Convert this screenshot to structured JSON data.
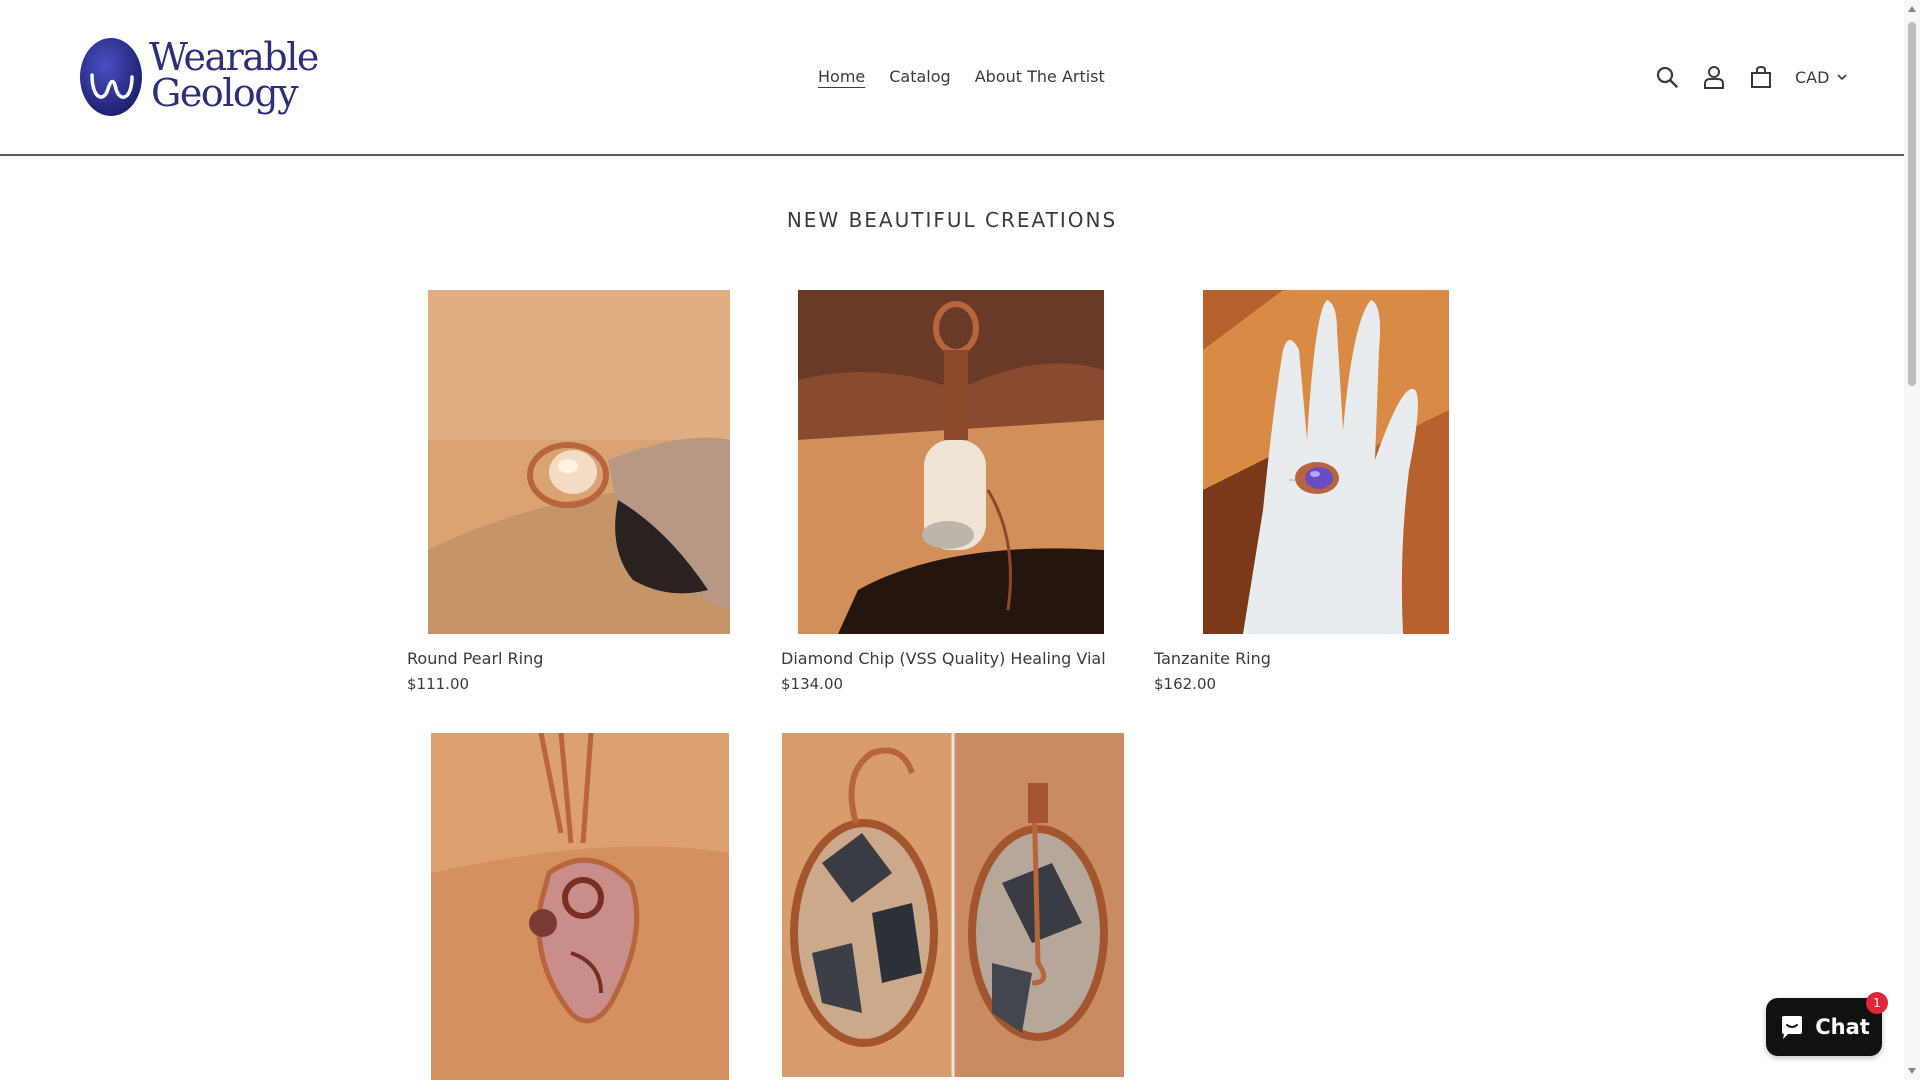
{
  "brand": {
    "logo_line1": "Wearable",
    "logo_line2": "Geology",
    "color": "#2e2f7a"
  },
  "nav": {
    "items": [
      "Home",
      "Catalog",
      "About The Artist"
    ],
    "active": "Home"
  },
  "header_icons": [
    "search-icon",
    "account-icon",
    "cart-icon"
  ],
  "currency": {
    "selected": "CAD"
  },
  "section": {
    "title": "NEW BEAUTIFUL CREATIONS"
  },
  "products": [
    {
      "title": "Round Pearl Ring",
      "price": "$111.00"
    },
    {
      "title": "Diamond Chip (VSS Quality) Healing Vial",
      "price": "$134.00"
    },
    {
      "title": "Tanzanite Ring",
      "price": "$162.00"
    },
    {
      "title": "",
      "price": ""
    },
    {
      "title": "",
      "price": ""
    }
  ],
  "chat": {
    "label": "Chat",
    "badge": "1"
  },
  "colors": {
    "accent": "#2e2f7a",
    "badge": "#e0263c",
    "copper": "#b8653d",
    "sandstone": "#d99a6a"
  }
}
